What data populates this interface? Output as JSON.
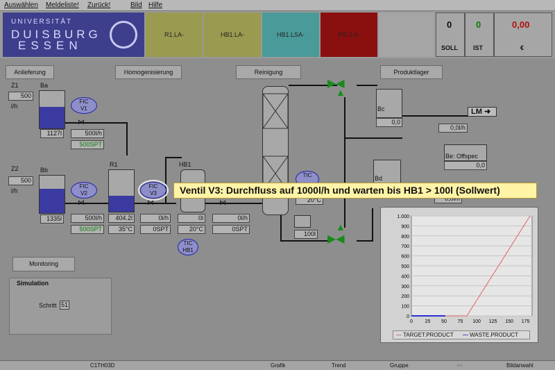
{
  "menu": [
    "Auswählen",
    "Meldeliste!",
    "Zurück!",
    "Bild",
    "Hilfe"
  ],
  "logo": {
    "l1": "UNIVERSITÄT",
    "l2": "DUISBURG",
    "l3": "ESSEN"
  },
  "alarms": [
    "R1.LA-",
    "HB1.LA-",
    "HB1.LSA-",
    "FIC LA-"
  ],
  "header": {
    "soll_value": "0",
    "ist_value": "0",
    "euro_value": "0,00",
    "soll_label": "SOLL",
    "ist_label": "IST",
    "euro_label": "€"
  },
  "sections": [
    "Anlieferung",
    "Homogenisierung",
    "Reinigung",
    "Produktlager"
  ],
  "z1": {
    "label": "Z1",
    "value": "500",
    "unit": "l/h"
  },
  "z2": {
    "label": "Z2",
    "value": "500",
    "unit": "l/h"
  },
  "ba": {
    "label": "Ba",
    "value": "1127l"
  },
  "bb": {
    "label": "Bb",
    "value": "1335l"
  },
  "r1": {
    "label": "R1",
    "value": "404.2l",
    "temp": "35°C"
  },
  "hb1": {
    "label": "HB1",
    "value": "0l",
    "temp": "20°C"
  },
  "v1": {
    "tag1": "FIC",
    "tag2": "V1",
    "flow": "500l/h",
    "spt": "500SPT"
  },
  "v2": {
    "tag1": "FIC",
    "tag2": "V2",
    "flow": "500l/h",
    "spt": "500SPT"
  },
  "v3": {
    "tag1": "FIC",
    "tag2": "V3",
    "flow": "0l/h",
    "spt": "0SPT"
  },
  "v4": {
    "flow": "0l/h",
    "spt": "0SPT"
  },
  "tic_hb1": {
    "tag1": "TIC",
    "tag2": "HB1"
  },
  "tic2": {
    "tag1": "TIC",
    "temp": "20°C"
  },
  "reb": {
    "value": "100l"
  },
  "bc": {
    "label": "Bc",
    "value": "0,0"
  },
  "lm": {
    "label": "LM",
    "value": "0,0l/h"
  },
  "be": {
    "label": "Be: Offspec",
    "value": "0,0"
  },
  "bd": {
    "label": "Bd",
    "value": "0,0l/h"
  },
  "tooltip": "Ventil V3: Durchfluss auf 1000l/h und warten bis HB1 > 100l (Sollwert)",
  "monitoring": "Monitoring",
  "simulation": {
    "title": "Simulation",
    "label": "Schritt",
    "value": "51"
  },
  "bottom": [
    "C1TH03D",
    "Grafik",
    "Trend",
    "Gruppe",
    "<<",
    "Bildanwahl"
  ],
  "chart_data": {
    "type": "line",
    "x_ticks": [
      "0",
      "25",
      "50",
      "75",
      "100",
      "125",
      "150",
      "175"
    ],
    "y_ticks": [
      "0",
      "100",
      "200",
      "300",
      "400",
      "500",
      "600",
      "700",
      "800",
      "900",
      "1.000"
    ],
    "xlim": [
      0,
      185
    ],
    "ylim": [
      0,
      1000
    ],
    "series": [
      {
        "name": "TARGET.PRODUCT",
        "color": "#e06060",
        "x": [
          0,
          85,
          182
        ],
        "y": [
          0,
          0,
          1000
        ]
      },
      {
        "name": "WASTE.PRODUCT",
        "color": "#3030d0",
        "x": [
          0,
          52
        ],
        "y": [
          0,
          0
        ]
      }
    ]
  }
}
